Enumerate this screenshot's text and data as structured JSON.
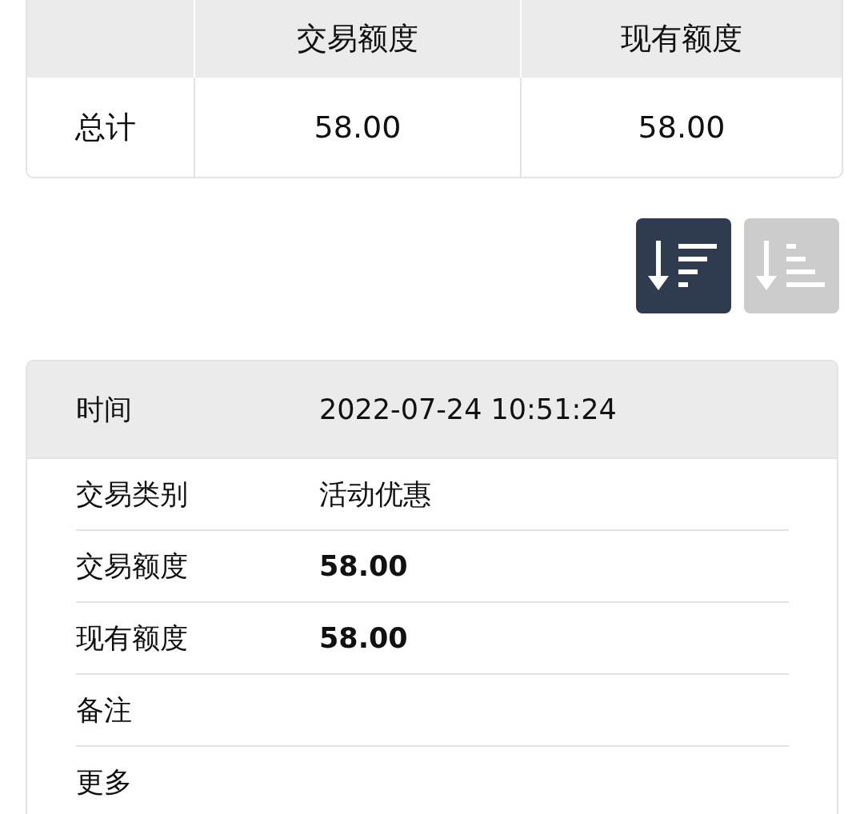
{
  "summary": {
    "columns": [
      "交易额度",
      "现有额度"
    ],
    "rows": [
      {
        "label": "总计",
        "values": [
          "58.00",
          "58.00"
        ]
      }
    ]
  },
  "sort_buttons": [
    {
      "kind": "descending",
      "selected": true
    },
    {
      "kind": "ascending",
      "selected": false
    }
  ],
  "record": {
    "header": {
      "label": "时间",
      "value": "2022-07-24 10:51:24"
    },
    "fields": [
      {
        "label": "交易类别",
        "value": "活动优惠",
        "bold": false
      },
      {
        "label": "交易额度",
        "value": "58.00",
        "bold": true
      },
      {
        "label": "现有额度",
        "value": "58.00",
        "bold": true
      },
      {
        "label": "备注"
      },
      {
        "label": "更多"
      }
    ]
  }
}
